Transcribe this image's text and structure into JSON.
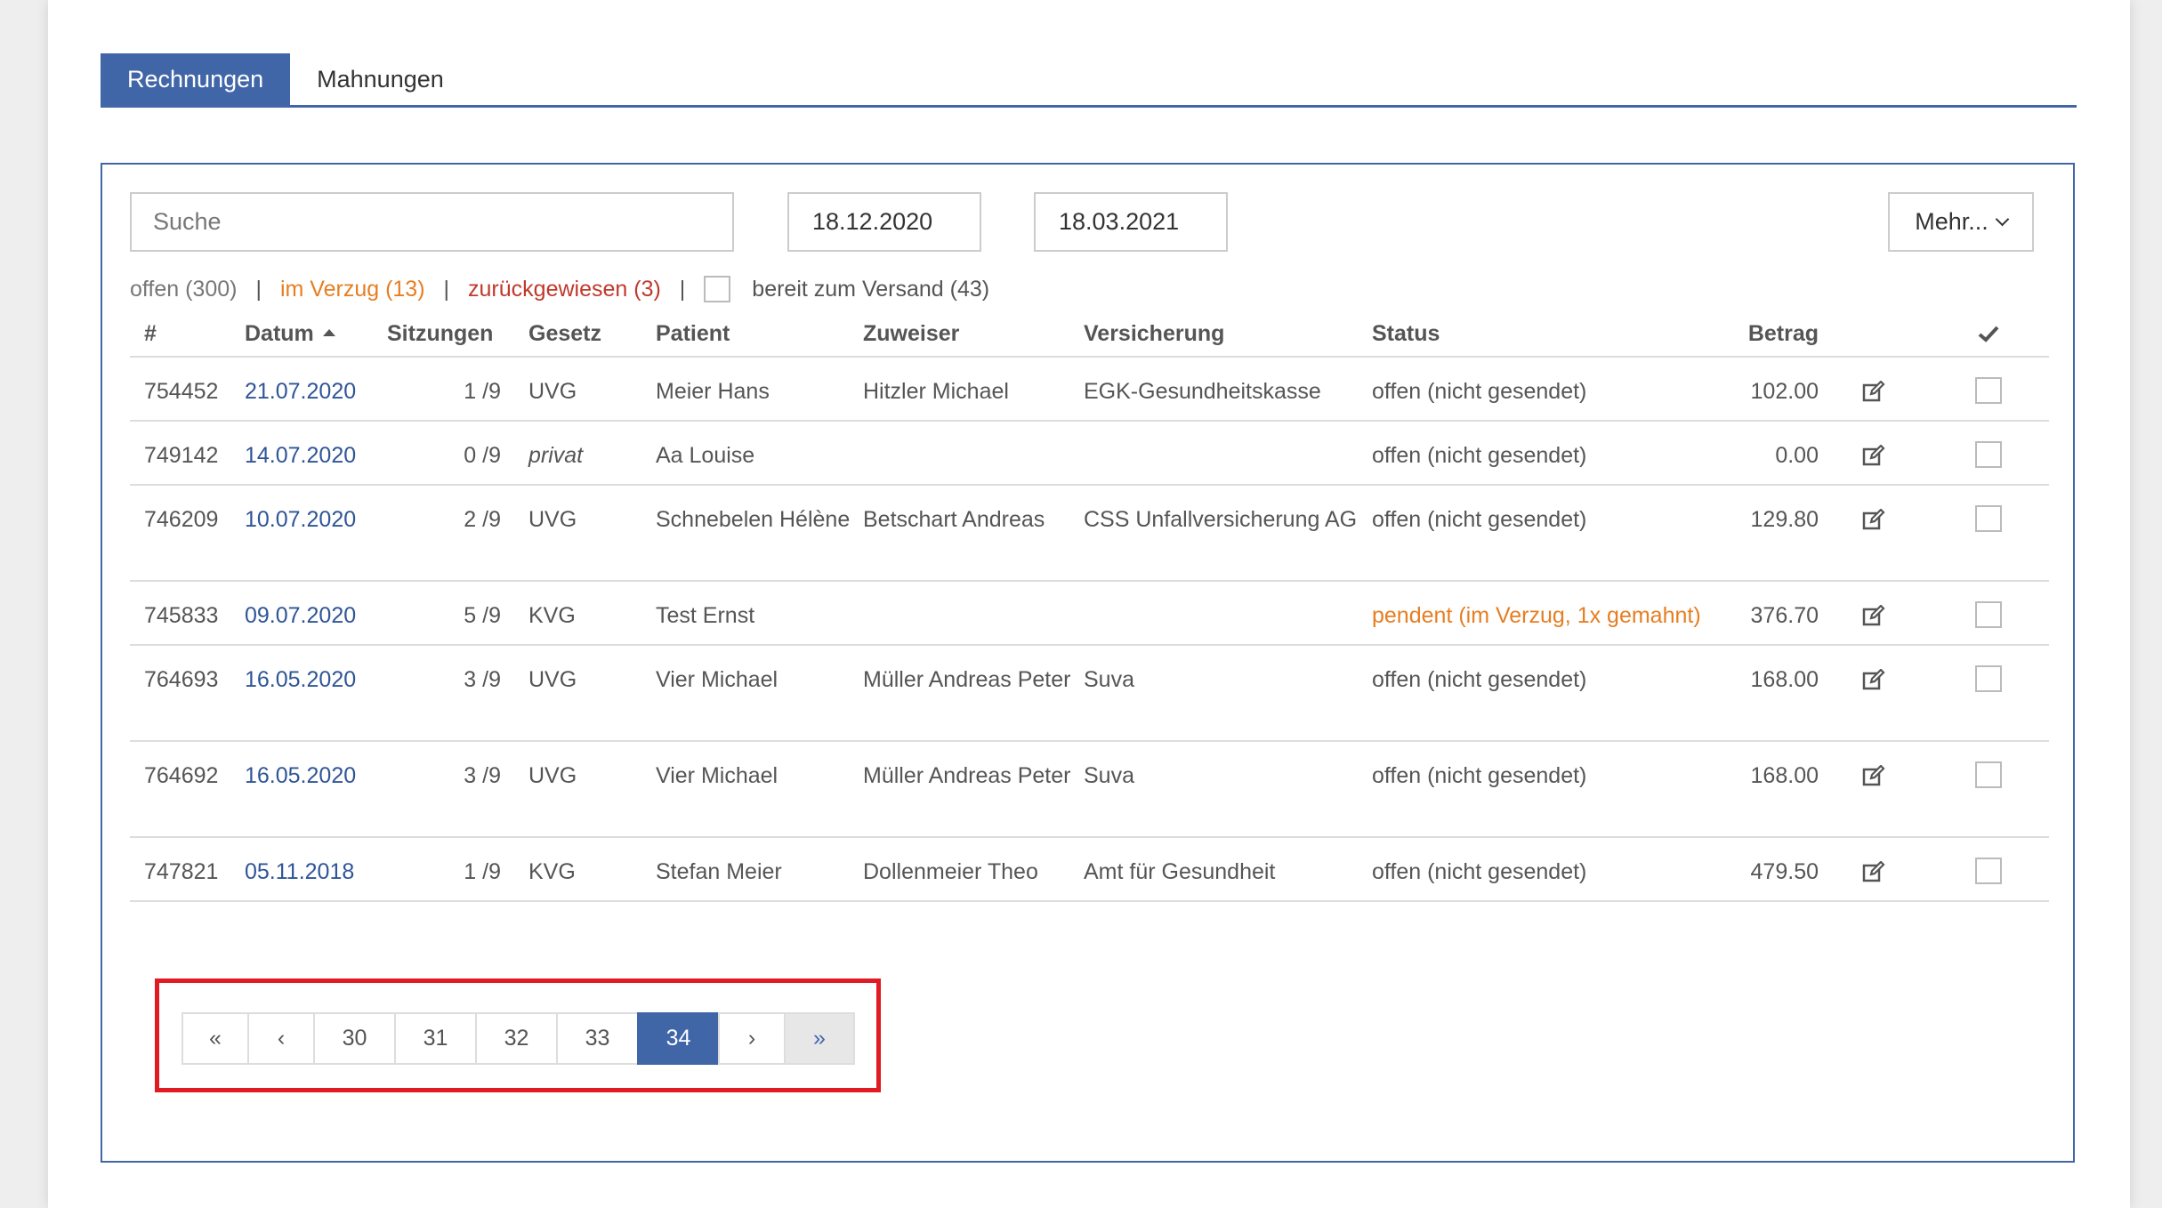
{
  "tabs": [
    {
      "label": "Rechnungen",
      "active": true
    },
    {
      "label": "Mahnungen",
      "active": false
    }
  ],
  "toolbar": {
    "search_placeholder": "Suche",
    "date_from": "18.12.2020",
    "date_to": "18.03.2021",
    "more_label": "Mehr..."
  },
  "filters": {
    "open": "offen (300)",
    "overdue": "im Verzug (13)",
    "rejected": "zurückgewiesen (3)",
    "ready": "bereit zum Versand (43)",
    "separator": "|"
  },
  "table": {
    "headers": {
      "num": "#",
      "date": "Datum",
      "sessions": "Sitzungen",
      "law": "Gesetz",
      "patient": "Patient",
      "referrer": "Zuweiser",
      "insurance": "Versicherung",
      "status": "Status",
      "amount": "Betrag"
    },
    "sort_column": "date",
    "rows": [
      {
        "num": "754452",
        "date": "21.07.2020",
        "sessions": "1 /9",
        "law": "UVG",
        "patient": "Meier Hans",
        "referrer": "Hitzler Michael",
        "insurance": "EGK-Gesundheitskasse",
        "status": "offen (nicht gesendet)",
        "amount": "102.00"
      },
      {
        "num": "749142",
        "date": "14.07.2020",
        "sessions": "0 /9",
        "law": "privat",
        "patient": "Aa Louise",
        "referrer": "",
        "insurance": "",
        "status": "offen (nicht gesendet)",
        "amount": "0.00"
      },
      {
        "num": "746209",
        "date": "10.07.2020",
        "sessions": "2 /9",
        "law": "UVG",
        "patient": "Schnebelen Hélène",
        "referrer": "Betschart Andreas",
        "insurance": "CSS Unfallversicherung AG",
        "status": "offen (nicht gesendet)",
        "amount": "129.80"
      },
      {
        "num": "745833",
        "date": "09.07.2020",
        "sessions": "5 /9",
        "law": "KVG",
        "patient": "Test Ernst",
        "referrer": "",
        "insurance": "",
        "status": "pendent (im Verzug, 1x gemahnt)",
        "amount": "376.70"
      },
      {
        "num": "764693",
        "date": "16.05.2020",
        "sessions": "3 /9",
        "law": "UVG",
        "patient": "Vier Michael",
        "referrer": "Müller Andreas Peter",
        "insurance": "Suva",
        "status": "offen (nicht gesendet)",
        "amount": "168.00"
      },
      {
        "num": "764692",
        "date": "16.05.2020",
        "sessions": "3 /9",
        "law": "UVG",
        "patient": "Vier Michael",
        "referrer": "Müller Andreas Peter",
        "insurance": "Suva",
        "status": "offen (nicht gesendet)",
        "amount": "168.00"
      },
      {
        "num": "747821",
        "date": "05.11.2018",
        "sessions": "1 /9",
        "law": "KVG",
        "patient": "Stefan Meier",
        "referrer": "Dollenmeier Theo",
        "insurance": "Amt für Gesundheit",
        "status": "offen (nicht gesendet)",
        "amount": "479.50"
      }
    ]
  },
  "pagination": {
    "first": "«",
    "prev": "‹",
    "pages": [
      "30",
      "31",
      "32",
      "33",
      "34"
    ],
    "current": "34",
    "next": "›",
    "last": "»"
  },
  "colors": {
    "accent": "#4166a8",
    "link": "#2f5597",
    "overdue": "#e67e22",
    "rejected": "#c0392b",
    "highlight": "#e01b24"
  }
}
